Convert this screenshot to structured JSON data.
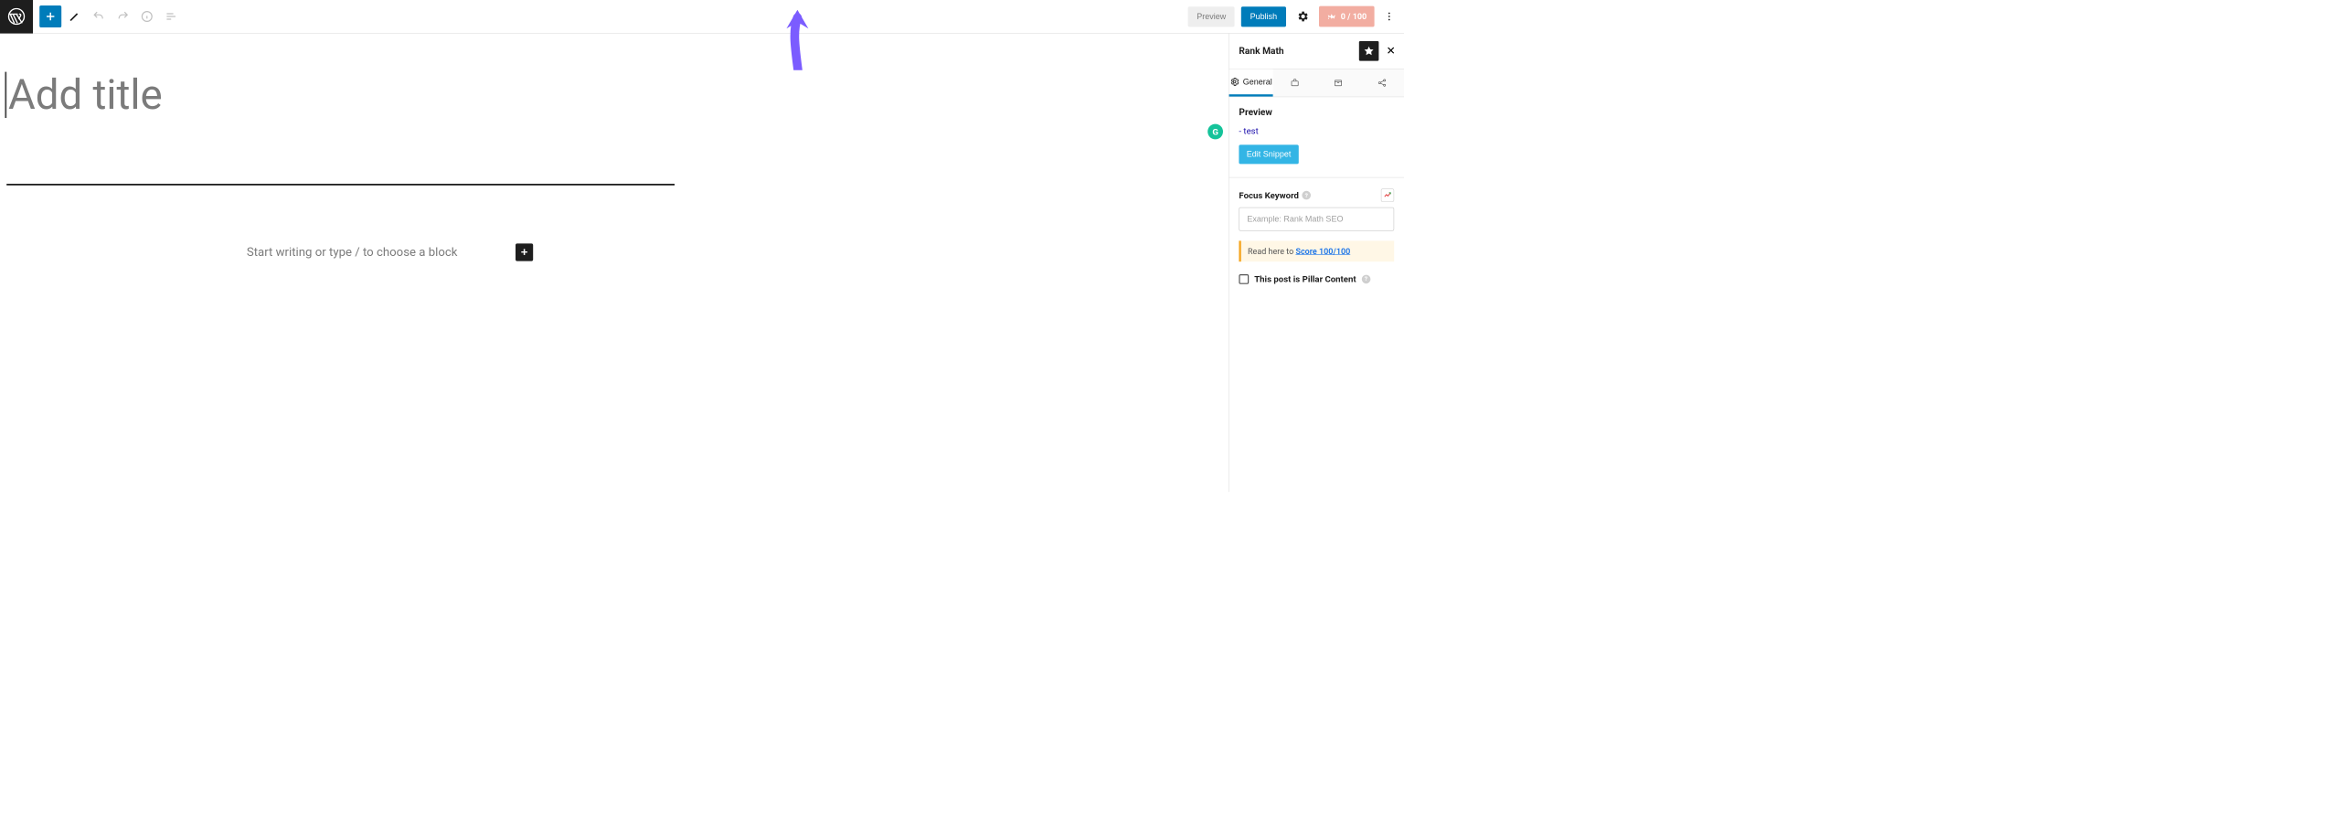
{
  "topbar": {
    "preview_label": "Preview",
    "publish_label": "Publish",
    "score_label": "0 / 100"
  },
  "editor": {
    "title_placeholder": "Add title",
    "block_placeholder": "Start writing or type / to choose a block"
  },
  "sidebar": {
    "title": "Rank Math",
    "tabs": {
      "general": "General"
    },
    "preview": {
      "heading": "Preview",
      "snippet_title": "- test",
      "edit_label": "Edit Snippet"
    },
    "focus_kw": {
      "label": "Focus Keyword",
      "placeholder": "Example: Rank Math SEO"
    },
    "tip": {
      "prefix": "Read here to ",
      "link": "Score 100/100"
    },
    "pillar": {
      "label": "This post is Pillar Content"
    }
  }
}
